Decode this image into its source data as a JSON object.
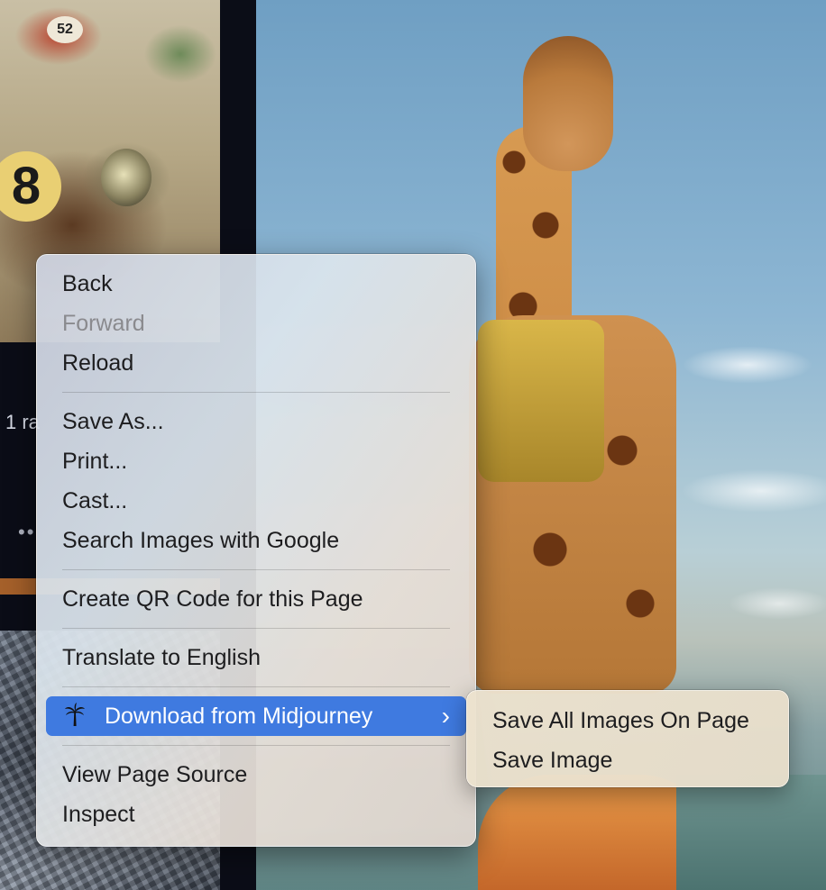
{
  "background": {
    "left_caption_fragment": "1 ra",
    "left_dots_fragment": "••",
    "race_car_number": "8",
    "race_car_plate": "52"
  },
  "context_menu": {
    "items": [
      {
        "label": "Back"
      },
      {
        "label": "Forward",
        "disabled": true
      },
      {
        "label": "Reload"
      },
      {
        "label": "Save As..."
      },
      {
        "label": "Print..."
      },
      {
        "label": "Cast..."
      },
      {
        "label": "Search Images with Google"
      },
      {
        "label": "Create QR Code for this Page"
      },
      {
        "label": "Translate to English"
      },
      {
        "label": "Download from Midjourney",
        "icon": "palm-tree-icon",
        "highlighted": true,
        "has_submenu": true
      },
      {
        "label": "View Page Source"
      },
      {
        "label": "Inspect"
      }
    ],
    "submenu_arrow": "›"
  },
  "submenu": {
    "items": [
      {
        "label": "Save All Images On Page"
      },
      {
        "label": "Save Image"
      }
    ]
  },
  "colors": {
    "highlight": "#3f7ae0",
    "menu_text": "#1d1d1f",
    "disabled_text": "#8a8a8e"
  }
}
